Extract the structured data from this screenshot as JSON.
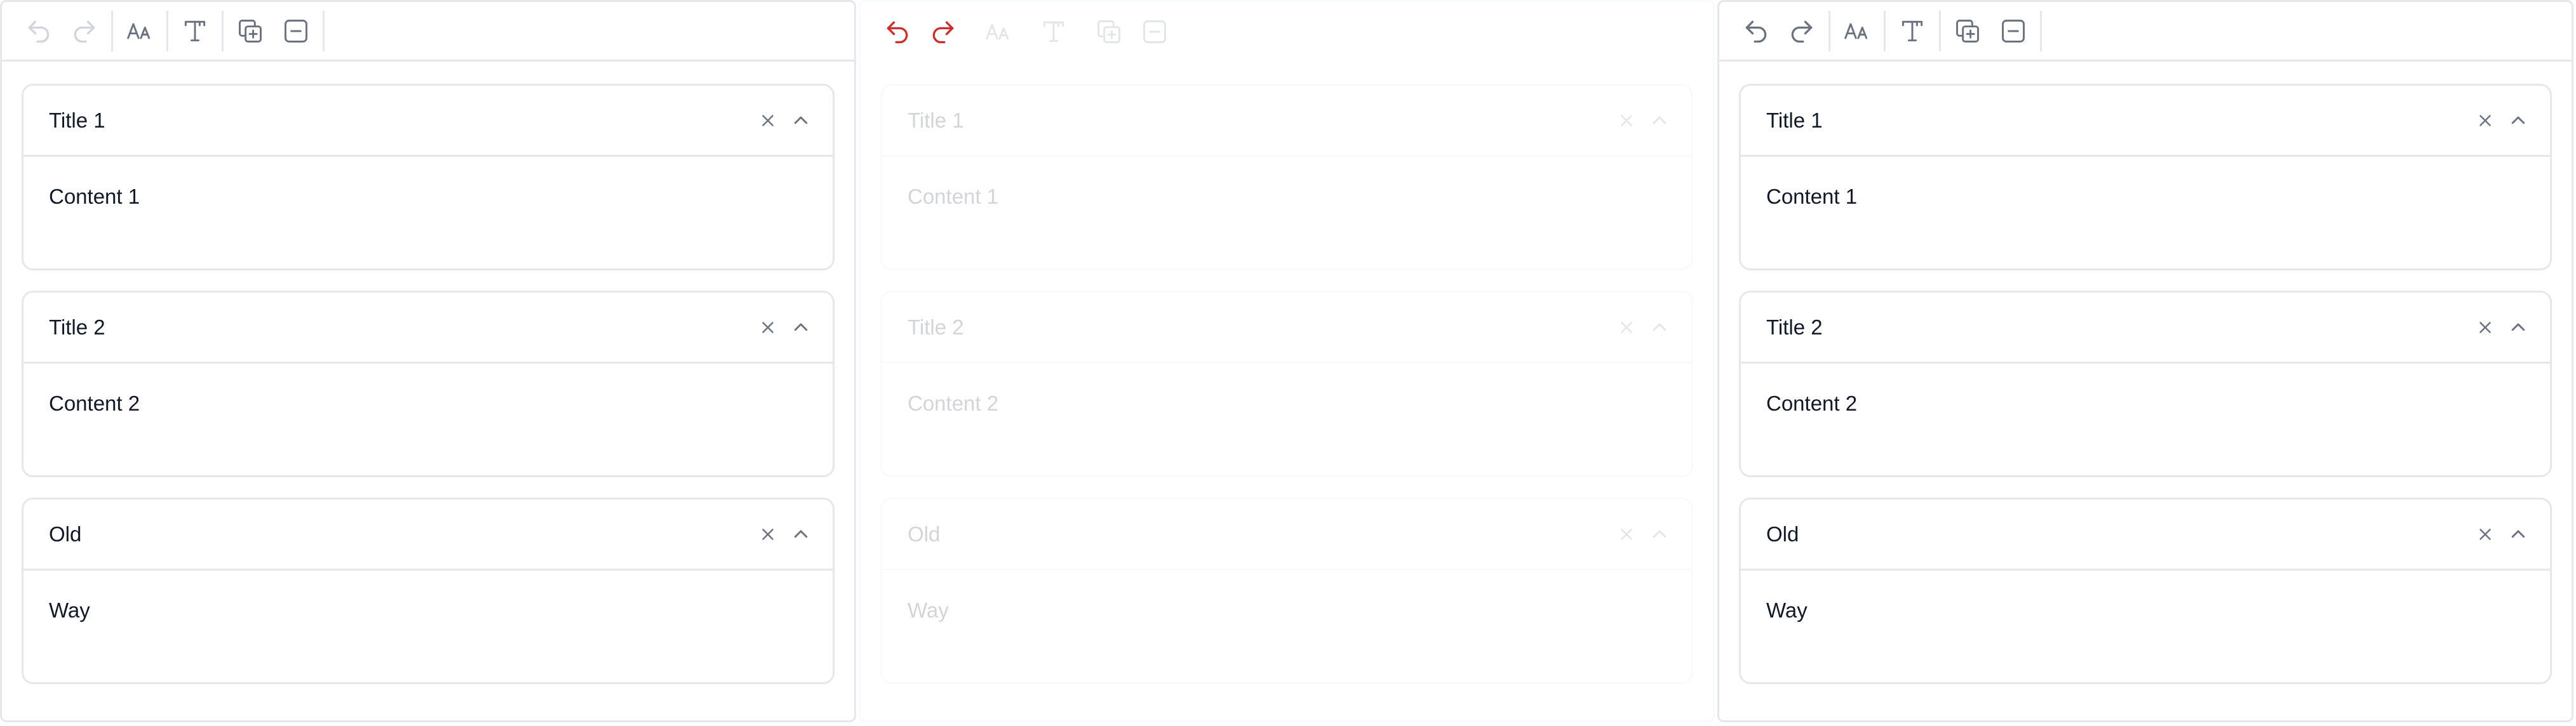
{
  "colors": {
    "border": "#e5e7eb",
    "icon_disabled": "#d1d5db",
    "icon_enabled": "#6b7280",
    "icon_active": "#dc2626",
    "text": "#111827"
  },
  "panels": [
    {
      "toolbar": {
        "undo": {
          "icon": "undo-icon",
          "state": "disabled"
        },
        "redo": {
          "icon": "redo-icon",
          "state": "disabled"
        },
        "text_size": {
          "icon": "text-size-icon",
          "state": "enabled"
        },
        "text_format": {
          "icon": "text-format-icon",
          "state": "enabled"
        },
        "duplicate": {
          "icon": "duplicate-add-icon",
          "state": "enabled"
        },
        "remove": {
          "icon": "remove-icon",
          "state": "enabled"
        }
      },
      "items": [
        {
          "title": "Title 1",
          "content": "Content 1"
        },
        {
          "title": "Title 2",
          "content": "Content 2"
        },
        {
          "title": "Old",
          "content": "Way"
        }
      ]
    },
    {
      "toolbar": {
        "undo": {
          "icon": "undo-icon",
          "state": "active"
        },
        "redo": {
          "icon": "redo-icon",
          "state": "active"
        },
        "text_size": {
          "icon": "text-size-icon",
          "state": "disabled"
        },
        "text_format": {
          "icon": "text-format-icon",
          "state": "disabled"
        },
        "duplicate": {
          "icon": "duplicate-add-icon",
          "state": "disabled"
        },
        "remove": {
          "icon": "remove-icon",
          "state": "disabled"
        }
      },
      "items": [
        {
          "title": "Title 1",
          "content": "Content 1"
        },
        {
          "title": "Title 2",
          "content": "Content 2"
        },
        {
          "title": "Old",
          "content": "Way"
        }
      ]
    },
    {
      "toolbar": {
        "undo": {
          "icon": "undo-icon",
          "state": "enabled"
        },
        "redo": {
          "icon": "redo-icon",
          "state": "enabled"
        },
        "text_size": {
          "icon": "text-size-icon",
          "state": "enabled"
        },
        "text_format": {
          "icon": "text-format-icon",
          "state": "enabled"
        },
        "duplicate": {
          "icon": "duplicate-add-icon",
          "state": "enabled"
        },
        "remove": {
          "icon": "remove-icon",
          "state": "enabled"
        }
      },
      "items": [
        {
          "title": "Title 1",
          "content": "Content 1"
        },
        {
          "title": "Title 2",
          "content": "Content 2"
        },
        {
          "title": "Old",
          "content": "Way"
        }
      ]
    }
  ]
}
